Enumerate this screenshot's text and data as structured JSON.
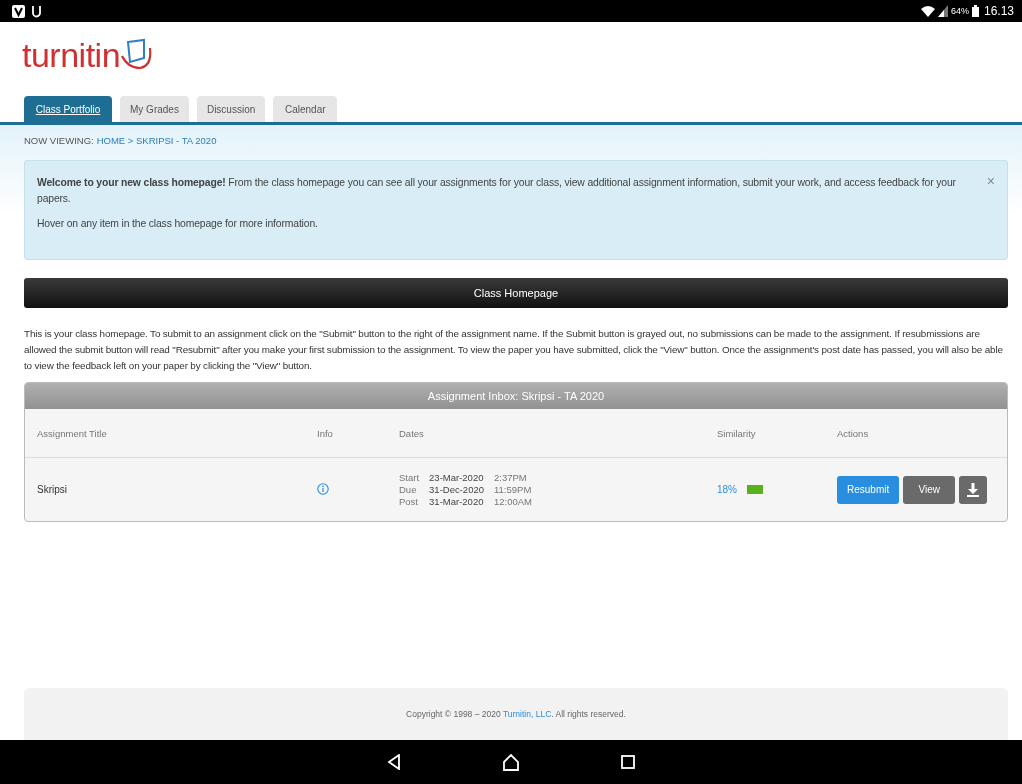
{
  "status_bar": {
    "battery": "64%",
    "time": "16.13"
  },
  "logo": {
    "text": "turnitin"
  },
  "tabs": [
    {
      "label": "Class Portfolio",
      "selected": true
    },
    {
      "label": "My Grades",
      "selected": false
    },
    {
      "label": "Discussion",
      "selected": false
    },
    {
      "label": "Calendar",
      "selected": false
    }
  ],
  "breadcrumb": {
    "prefix": "NOW VIEWING:",
    "path": "HOME > SKRIPSI - TA 2020"
  },
  "alert": {
    "message": "**Welcome to your new class homepage!** From the class homepage you can see all your assignments for your class, view additional assignment information, submit your work, and access feedback for your papers.",
    "hint": "Hover on any item in the class homepage for more information.",
    "close": "×"
  },
  "section_title": "Class Homepage",
  "intro": "This is your class homepage. To submit to an assignment click on the \"Submit\" button to the right of the assignment name. If the Submit button is grayed out, no submissions can be made to the assignment. If resubmissions are allowed the submit button will read \"Resubmit\" after you make your first submission to the assignment. To view the paper you have submitted, click the \"View\" button. Once the assignment's post date has passed, you will also be able to view the feedback left on your paper by clicking the \"View\" button.",
  "inbox": {
    "title": "Assignment Inbox: Skripsi - TA 2020",
    "columns": [
      "Assignment Title",
      "Info",
      "Dates",
      "Similarity",
      "Actions"
    ],
    "rows": [
      {
        "title": "Skripsi",
        "dates": [
          {
            "label": "Start",
            "date": "23-Mar-2020",
            "time": "2:37PM"
          },
          {
            "label": "Due",
            "date": "31-Dec-2020",
            "time": "11:59PM"
          },
          {
            "label": "Post",
            "date": "31-Mar-2020",
            "time": "12:00AM"
          }
        ],
        "similarity": "18%",
        "actions": [
          "Resubmit",
          "View"
        ]
      }
    ]
  },
  "footer": {
    "before": "Copyright © 1998 – 2020 ",
    "link": "Turnitin, LLC",
    "after": ". All rights reserved."
  }
}
